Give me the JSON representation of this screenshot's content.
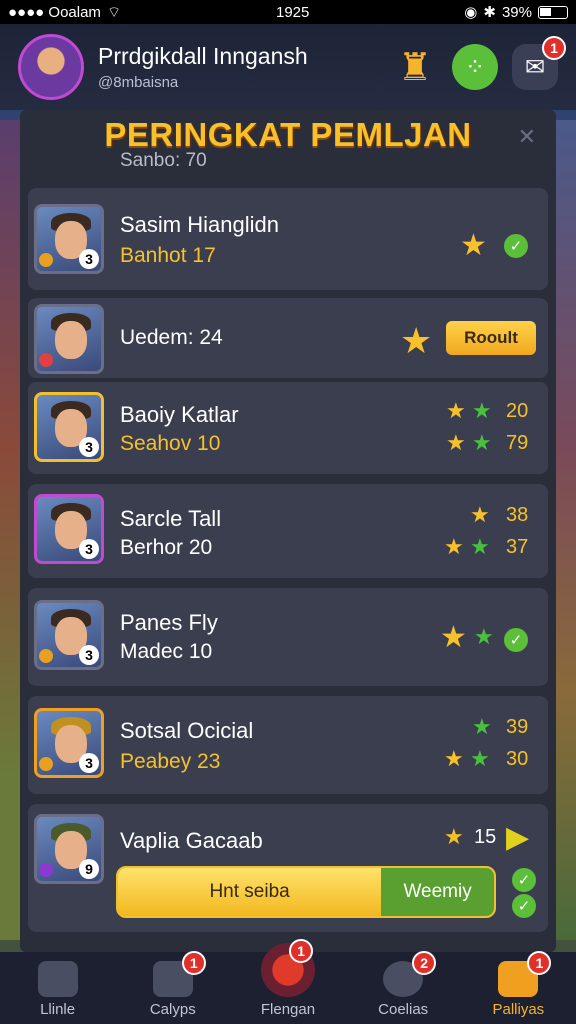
{
  "status_bar": {
    "carrier": "●●●● Ooalam",
    "time": "1925",
    "battery": "39%"
  },
  "header": {
    "name": "Prrdgikdall Inngansh",
    "subtitle": "@8mbaisna",
    "mail_badge": "1"
  },
  "panel": {
    "title": "PERINGKAT PEMLJAN",
    "peek_top_score": "Sanbo: 70"
  },
  "rows": [
    {
      "name": "Sasim Hianglidn",
      "score": "Banhot 17",
      "rank": "3"
    },
    {
      "name": "",
      "score": "Uedem: 24",
      "action_label": "Rooult"
    },
    {
      "name": "Baoiy Katlar",
      "score": "Seahov 10",
      "rank": "3",
      "val1": "20",
      "val2": "79"
    },
    {
      "name": "Sarcle Tall",
      "score": "Berhor 20",
      "rank": "3",
      "val1": "38",
      "val2": "37"
    },
    {
      "name": "Panes Fly",
      "score": "Madec 10",
      "rank": "3"
    },
    {
      "name": "Sotsal Ocicial",
      "score": "Peabey 23",
      "rank": "3",
      "val1": "39",
      "val2": "30"
    },
    {
      "name": "Vaplia Gacaab",
      "rank": "9",
      "val1": "15",
      "progress": {
        "left_label": "Hnt seiba",
        "right_label": "Weemiy",
        "fill": 0.7
      }
    }
  ],
  "colors": {
    "accent": "#f6c12a",
    "green": "#5bbf3a",
    "badge": "#e0302a",
    "panel": "#2a2d3a"
  },
  "bottom_nav": [
    {
      "label": "Llinle",
      "icon": "home-icon",
      "badge": ""
    },
    {
      "label": "Calyps",
      "icon": "gift-icon",
      "badge": "1"
    },
    {
      "label": "Flengan",
      "icon": "battle-icon",
      "badge": "1"
    },
    {
      "label": "Coelias",
      "icon": "target-icon",
      "badge": "2"
    },
    {
      "label": "Palliyas",
      "icon": "chest-icon",
      "badge": "1"
    }
  ]
}
